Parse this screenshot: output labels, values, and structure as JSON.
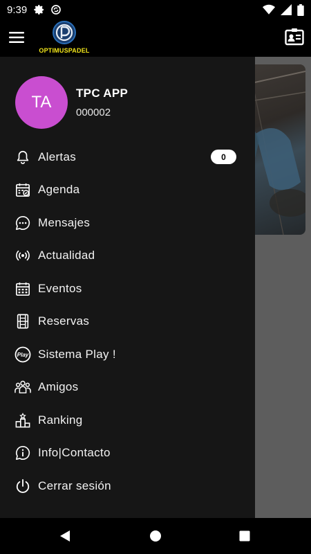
{
  "status_bar": {
    "time": "9:39",
    "left_icons": [
      "gear-icon",
      "sync-icon"
    ],
    "right_icons": [
      "wifi-icon",
      "signal-icon",
      "battery-icon"
    ]
  },
  "app_bar": {
    "logo_text": "OPTIMUSPADEL",
    "menu_icon": "hamburger-icon",
    "action_icon": "contact-card-icon"
  },
  "drawer": {
    "profile": {
      "initials": "TA",
      "name": "TPC APP",
      "id": "000002",
      "avatar_color": "#c94ed0"
    },
    "items": [
      {
        "label": "Alertas",
        "icon": "bell-icon",
        "badge": "0"
      },
      {
        "label": "Agenda",
        "icon": "calendar-check-icon"
      },
      {
        "label": "Mensajes",
        "icon": "chat-bubble-icon"
      },
      {
        "label": "Actualidad",
        "icon": "broadcast-icon"
      },
      {
        "label": "Eventos",
        "icon": "calendar-grid-icon"
      },
      {
        "label": "Reservas",
        "icon": "court-icon"
      },
      {
        "label": "Sistema Play !",
        "icon": "play-badge-icon"
      },
      {
        "label": "Amigos",
        "icon": "people-icon"
      },
      {
        "label": "Ranking",
        "icon": "podium-icon"
      },
      {
        "label": "Info|Contacto",
        "icon": "info-icon"
      },
      {
        "label": "Cerrar sesión",
        "icon": "power-icon"
      }
    ]
  },
  "nav_bar": {
    "buttons": [
      "back-icon",
      "home-icon",
      "recents-icon"
    ]
  },
  "colors": {
    "drawer_bg": "#161616",
    "avatar": "#c94ed0",
    "logo_accent": "#f2e61a",
    "logo_blue": "#2a6fb8"
  }
}
